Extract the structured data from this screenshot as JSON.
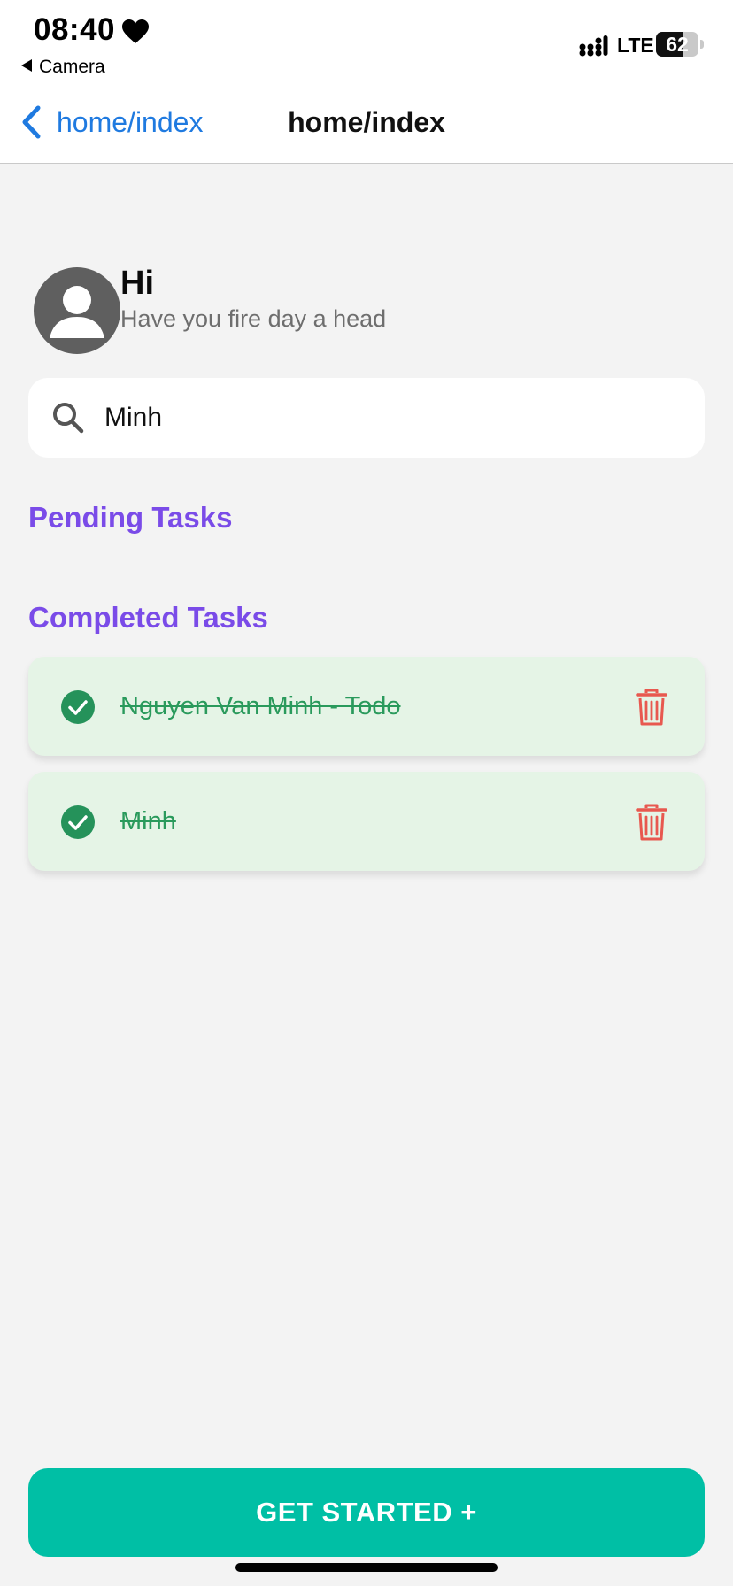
{
  "status_bar": {
    "time": "08:40",
    "back_app": "Camera",
    "network": "LTE",
    "battery": "62",
    "battery_level": 0.62,
    "icons": [
      "heart-icon",
      "signal-icon",
      "battery-icon"
    ]
  },
  "nav": {
    "back_label": "home/index",
    "title": "home/index",
    "back_icon": "chevron-left-icon"
  },
  "greeting": {
    "title": "Hi",
    "subtitle": "Have you fire day a head",
    "avatar_icon": "user-avatar-icon"
  },
  "search": {
    "value": "Minh",
    "icon": "search-icon"
  },
  "sections": {
    "pending_title": "Pending Tasks",
    "completed_title": "Completed Tasks"
  },
  "completed_tasks": [
    {
      "text": "Nguyen Van Minh - Todo",
      "done": true
    },
    {
      "text": "Minh",
      "done": true
    }
  ],
  "cta": {
    "label": "GET STARTED +"
  },
  "colors": {
    "accent_purple": "#7a4be8",
    "nav_blue": "#1f7ae0",
    "completed_green": "#2a9a5c",
    "card_bg": "#e5f4e6",
    "delete_red": "#e8584f",
    "cta_teal": "#00bfa5"
  }
}
